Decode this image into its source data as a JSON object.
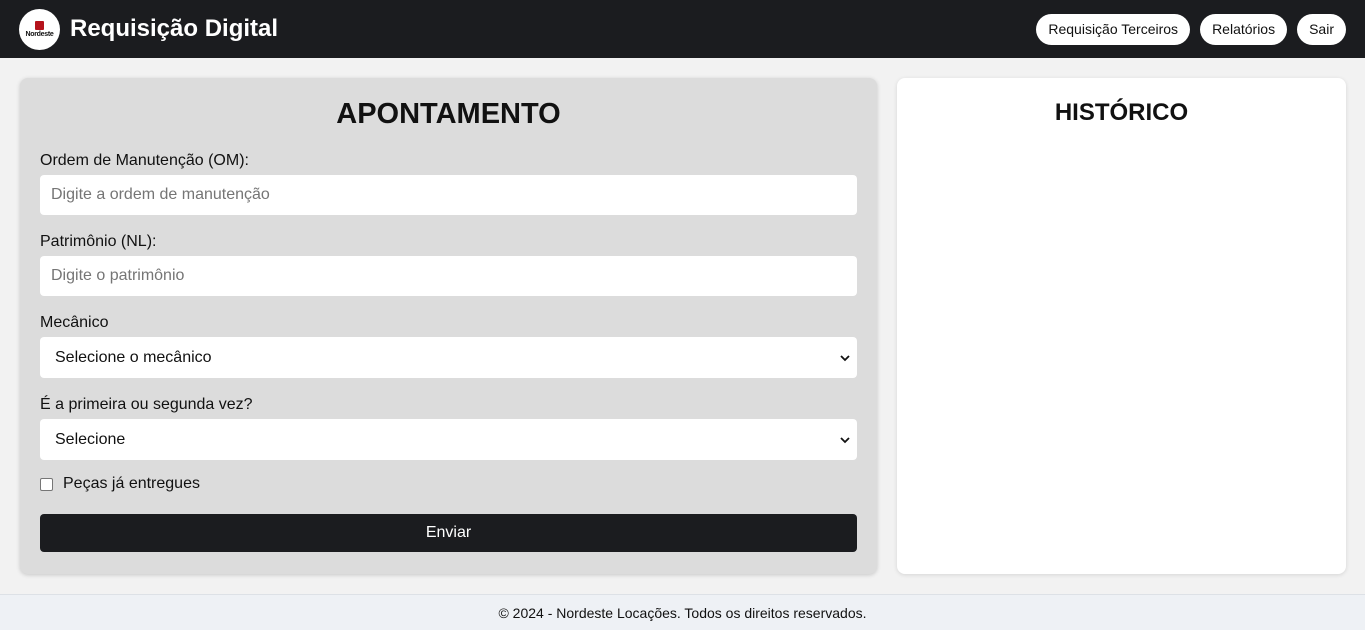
{
  "header": {
    "logo_text": "Nordeste",
    "title": "Requisição Digital",
    "nav": [
      "Requisição Terceiros",
      "Relatórios",
      "Sair"
    ]
  },
  "form": {
    "title": "APONTAMENTO",
    "om": {
      "label": "Ordem de Manutenção (OM):",
      "placeholder": "Digite a ordem de manutenção"
    },
    "patrimonio": {
      "label": "Patrimônio (NL):",
      "placeholder": "Digite o patrimônio"
    },
    "mecanico": {
      "label": "Mecânico",
      "selected": "Selecione o mecânico"
    },
    "vez": {
      "label": "É a primeira ou segunda vez?",
      "selected": "Selecione"
    },
    "pecas": {
      "label": "Peças já entregues",
      "checked": false
    },
    "submit": "Enviar"
  },
  "history": {
    "title": "HISTÓRICO"
  },
  "footer": {
    "text": "© 2024 - Nordeste Locações. Todos os direitos reservados."
  },
  "colors": {
    "topbar": "#1b1c1f",
    "form_panel": "#dcdcdc",
    "page_bg": "#f2f2f2",
    "footer_bg": "#eef1f5"
  }
}
